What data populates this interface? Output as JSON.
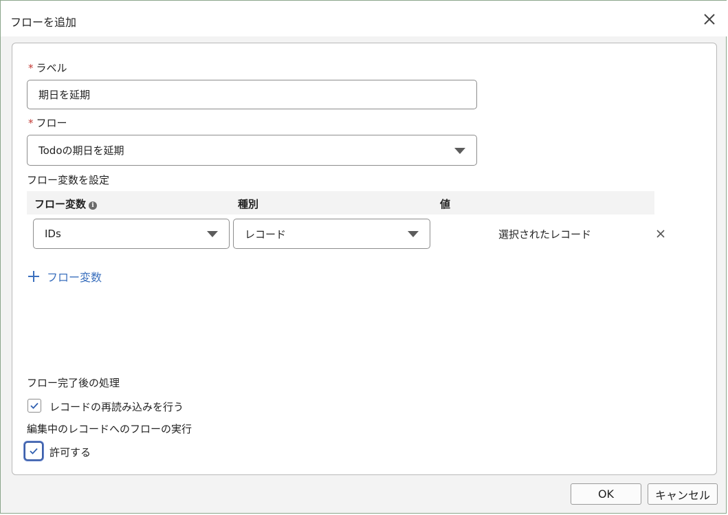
{
  "dialog": {
    "title": "フローを追加",
    "close_icon": "close-icon"
  },
  "form": {
    "label_field": {
      "required_mark": "*",
      "label": "ラベル",
      "value": "期日を延期"
    },
    "flow_field": {
      "required_mark": "*",
      "label": "フロー",
      "selected": "Todoの期日を延期"
    },
    "variables": {
      "section_label": "フロー変数を設定",
      "headers": {
        "variable": "フロー変数",
        "type": "種別",
        "value": "値"
      },
      "info_icon": "info-icon",
      "rows": [
        {
          "variable": "IDs",
          "type": "レコード",
          "value": "選択されたレコード"
        }
      ],
      "add_label": "フロー変数"
    },
    "after_completion": {
      "section_label": "フロー完了後の処理",
      "reload_label": "レコードの再読み込みを行う",
      "reload_checked": true
    },
    "run_on_edit": {
      "section_label": "編集中のレコードへのフローの実行",
      "allow_label": "許可する",
      "allow_checked": true
    }
  },
  "footer": {
    "ok_label": "OK",
    "cancel_label": "キャンセル"
  },
  "colors": {
    "required": "#c23934",
    "link": "#3a6fbd",
    "focus_ring": "#3c5fa8"
  }
}
